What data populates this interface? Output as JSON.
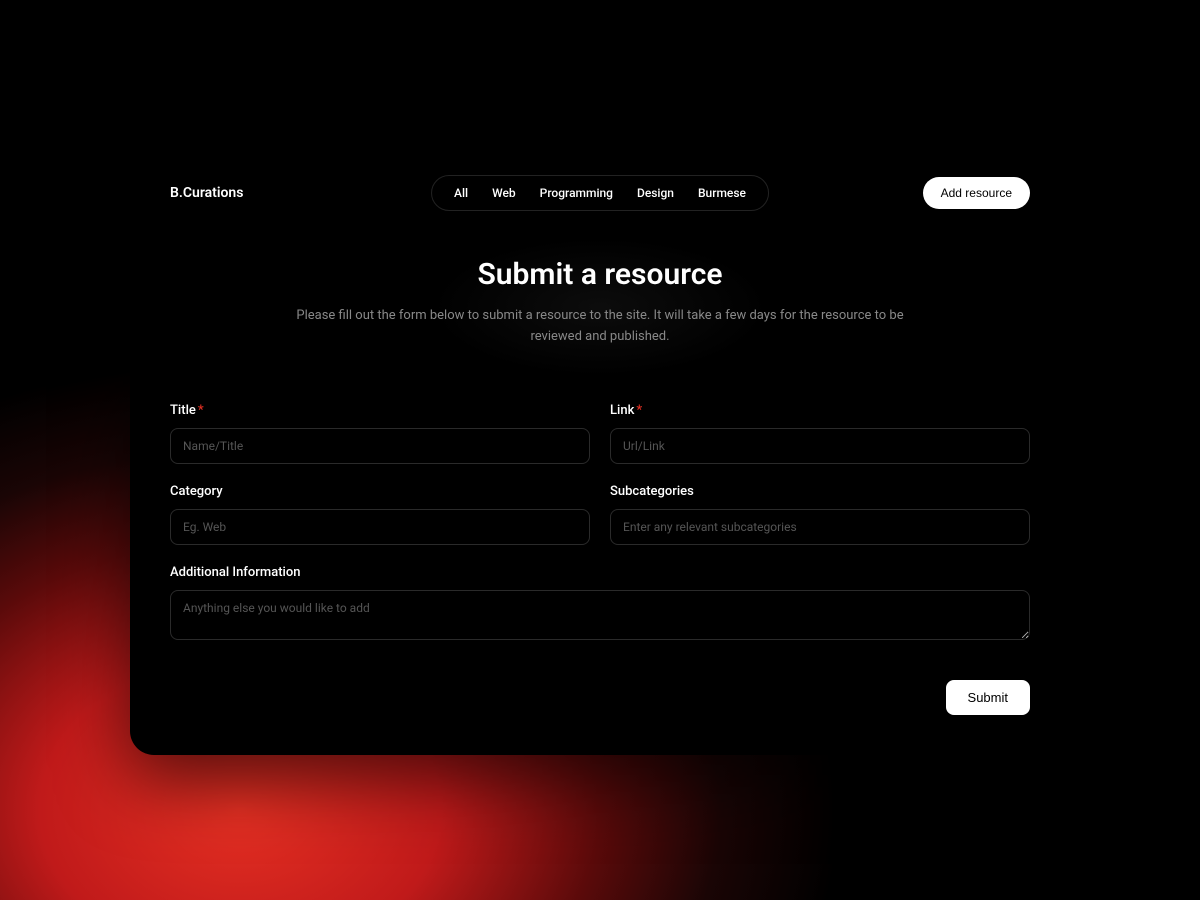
{
  "brand": "B.Curations",
  "nav": {
    "items": [
      "All",
      "Web",
      "Programming",
      "Design",
      "Burmese"
    ]
  },
  "cta": {
    "label": "Add resource"
  },
  "hero": {
    "title": "Submit a resource",
    "subtitle": "Please fill out the form below to submit a resource to the site. It will take a few days for the resource to be reviewed and published."
  },
  "form": {
    "title": {
      "label": "Title",
      "placeholder": "Name/Title",
      "required": true
    },
    "link": {
      "label": "Link",
      "placeholder": "Url/Link",
      "required": true
    },
    "category": {
      "label": "Category",
      "placeholder": "Eg. Web",
      "required": false
    },
    "subcategories": {
      "label": "Subcategories",
      "placeholder": "Enter any relevant subcategories",
      "required": false
    },
    "additional": {
      "label": "Additional Information",
      "placeholder": "Anything else you would like to add",
      "required": false
    },
    "required_marker": "*",
    "submit_label": "Submit"
  }
}
